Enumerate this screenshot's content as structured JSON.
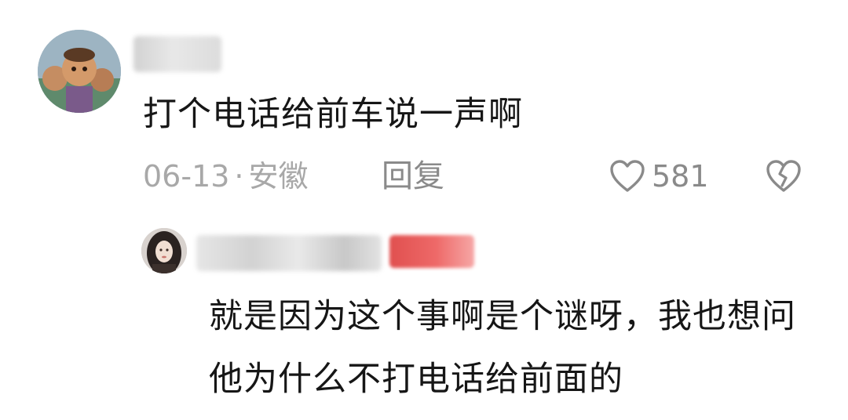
{
  "comment": {
    "text": "打个电话给前车说一声啊",
    "date": "06-13",
    "separator": "·",
    "location": "安徽",
    "reply_label": "回复",
    "like_count": "581",
    "like_icon": "heart-outline-icon",
    "dislike_icon": "broken-heart-icon"
  },
  "reply": {
    "text": "就是因为这个事啊是个谜呀，我也想问他为什么不打电话给前面的"
  },
  "colors": {
    "text_primary": "#161616",
    "text_secondary": "#a8a8a8",
    "icon": "#8a8a8a",
    "badge": "#e85a59",
    "background": "#ffffff"
  }
}
